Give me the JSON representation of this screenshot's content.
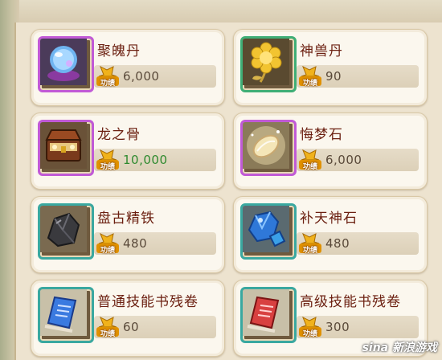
{
  "items": [
    {
      "name": "聚魄丹",
      "price": "6,000",
      "badge": "功绩",
      "frame": "purple",
      "icon": "crystal-orb-icon",
      "price_color": "default"
    },
    {
      "name": "神兽丹",
      "price": "90",
      "badge": "功绩",
      "frame": "green",
      "icon": "golden-flower-icon",
      "price_color": "default"
    },
    {
      "name": "龙之骨",
      "price": "10,000",
      "badge": "功绩",
      "frame": "purple",
      "icon": "treasure-chest-icon",
      "price_color": "green"
    },
    {
      "name": "悔梦石",
      "price": "6,000",
      "badge": "功绩",
      "frame": "purple",
      "icon": "glowing-stone-icon",
      "price_color": "default"
    },
    {
      "name": "盘古精铁",
      "price": "480",
      "badge": "功绩",
      "frame": "teal",
      "icon": "dark-ore-icon",
      "price_color": "default"
    },
    {
      "name": "补天神石",
      "price": "480",
      "badge": "功绩",
      "frame": "teal",
      "icon": "blue-gem-icon",
      "price_color": "default"
    },
    {
      "name": "普通技能书残卷",
      "price": "60",
      "badge": "功绩",
      "frame": "teal",
      "icon": "blue-scroll-icon",
      "price_color": "default"
    },
    {
      "name": "高级技能书残卷",
      "price": "300",
      "badge": "功绩",
      "frame": "teal",
      "icon": "red-scroll-icon",
      "price_color": "default"
    }
  ],
  "watermark": "sina 新浪游戏",
  "colors": {
    "name": "#6b1f10",
    "price": "#5a4a3a",
    "price_green": "#2f8a2f",
    "frame_purple": "#c15ad6",
    "frame_green": "#3fae76",
    "frame_teal": "#3aa8a0"
  }
}
